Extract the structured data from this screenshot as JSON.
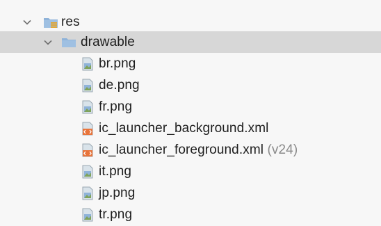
{
  "tree": {
    "root": {
      "label": "res"
    },
    "folder": {
      "label": "drawable"
    },
    "files": [
      {
        "label": "br.png",
        "type": "image"
      },
      {
        "label": "de.png",
        "type": "image"
      },
      {
        "label": "fr.png",
        "type": "image"
      },
      {
        "label": "ic_launcher_background.xml",
        "type": "xml"
      },
      {
        "label": "ic_launcher_foreground.xml",
        "qualifier": "(v24)",
        "type": "xml"
      },
      {
        "label": "it.png",
        "type": "image"
      },
      {
        "label": "jp.png",
        "type": "image"
      },
      {
        "label": "tr.png",
        "type": "image"
      }
    ]
  },
  "icons": {
    "chevron": "chevron-down-icon",
    "res_folder": "resource-folder-icon",
    "folder": "folder-icon",
    "image_file": "image-file-icon",
    "xml_file": "xml-file-icon"
  },
  "colors": {
    "selected_row": "#d7d7d7",
    "background": "#f7f7f7",
    "folder_blue": "#8fb3d9",
    "xml_orange": "#e8743b",
    "qualifier_gray": "#8a8a8a"
  }
}
